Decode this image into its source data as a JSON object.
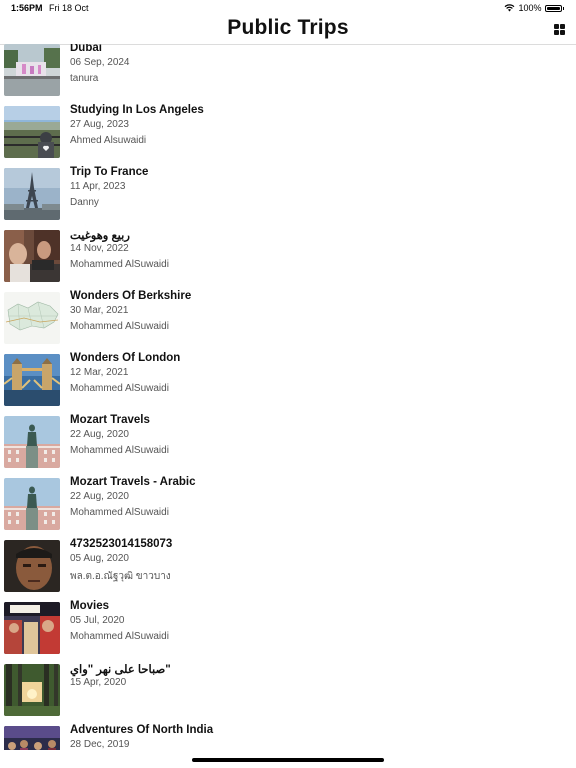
{
  "status_bar": {
    "time": "1:56PM",
    "date": "Fri 18 Oct",
    "battery": "100%"
  },
  "header": {
    "title": "Public Trips",
    "layout_toggle_icon": "grid-icon"
  },
  "trips": [
    {
      "title": "Dubai",
      "date": "06 Sep, 2024",
      "owner": "tanura",
      "thumbnail": "dubai-fountain-photo"
    },
    {
      "title": "Studying In Los Angeles",
      "date": "27 Aug, 2023",
      "owner": "Ahmed Alsuwaidi",
      "thumbnail": "city-view-photo"
    },
    {
      "title": "Trip To France",
      "date": "11 Apr, 2023",
      "owner": "Danny",
      "thumbnail": "eiffel-tower-photo"
    },
    {
      "title": "ربيع وهوغيت",
      "date": "14 Nov, 2022",
      "owner": "Mohammed AlSuwaidi",
      "thumbnail": "people-at-table-photo"
    },
    {
      "title": "Wonders Of Berkshire",
      "date": "30 Mar, 2021",
      "owner": "Mohammed AlSuwaidi",
      "thumbnail": "map-photo"
    },
    {
      "title": "Wonders Of London",
      "date": "12 Mar, 2021",
      "owner": "Mohammed AlSuwaidi",
      "thumbnail": "tower-bridge-photo"
    },
    {
      "title": "Mozart Travels",
      "date": "22 Aug, 2020",
      "owner": "Mohammed AlSuwaidi",
      "thumbnail": "statue-square-photo"
    },
    {
      "title": "Mozart Travels - Arabic",
      "date": "22 Aug, 2020",
      "owner": "Mohammed AlSuwaidi",
      "thumbnail": "statue-square-photo"
    },
    {
      "title": "4732523014158073",
      "date": "05 Aug, 2020",
      "owner": "พล.ต.อ.ณัฐวุฒิ ขาวบาง",
      "thumbnail": "portrait-photo"
    },
    {
      "title": "Movies",
      "date": "05 Jul, 2020",
      "owner": "Mohammed AlSuwaidi",
      "thumbnail": "movie-poster-photo"
    },
    {
      "title": "صباحا على نهر \"واي\"",
      "date": "15 Apr, 2020",
      "owner": "",
      "thumbnail": "forest-sunset-photo"
    },
    {
      "title": "Adventures Of North India",
      "date": "28 Dec, 2019",
      "owner": "",
      "thumbnail": "crowd-night-photo"
    }
  ]
}
